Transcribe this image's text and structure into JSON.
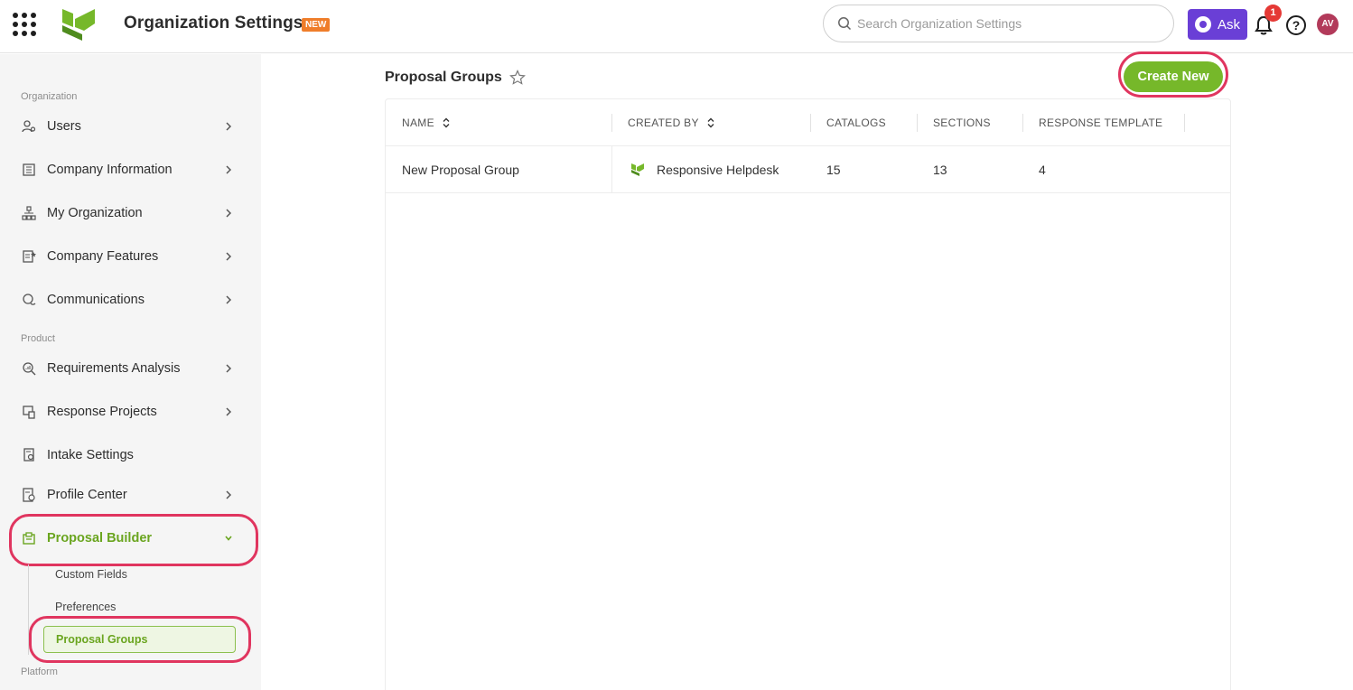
{
  "header": {
    "title": "Organization Settings",
    "badge": "NEW",
    "search_placeholder": "Search Organization Settings",
    "ask_label": "Ask",
    "notification_count": "1",
    "help_label": "?",
    "avatar_initials": "AV"
  },
  "sidebar": {
    "sections": {
      "organization": "Organization",
      "product": "Product",
      "platform": "Platform"
    },
    "items": [
      {
        "label": "Users",
        "icon": "users-icon"
      },
      {
        "label": "Company Information",
        "icon": "building-icon"
      },
      {
        "label": "My Organization",
        "icon": "org-chart-icon"
      },
      {
        "label": "Company Features",
        "icon": "features-icon"
      },
      {
        "label": "Communications",
        "icon": "chat-icon"
      },
      {
        "label": "Requirements Analysis",
        "icon": "search-analysis-icon"
      },
      {
        "label": "Response Projects",
        "icon": "projects-icon"
      },
      {
        "label": "Intake Settings",
        "icon": "intake-icon"
      },
      {
        "label": "Profile Center",
        "icon": "profile-icon"
      },
      {
        "label": "Proposal Builder",
        "icon": "proposal-icon"
      }
    ],
    "proposal_builder_subitems": [
      {
        "label": "Custom Fields"
      },
      {
        "label": "Preferences"
      },
      {
        "label": "Proposal Groups"
      }
    ]
  },
  "main": {
    "title": "Proposal Groups",
    "create_button": "Create New",
    "columns": [
      "NAME",
      "CREATED BY",
      "CATALOGS",
      "SECTIONS",
      "RESPONSE TEMPLATE"
    ],
    "rows": [
      {
        "name": "New Proposal Group",
        "created_by": "Responsive Helpdesk",
        "catalogs": "15",
        "sections": "13",
        "response_template": "4"
      }
    ]
  },
  "colors": {
    "brand_green": "#76b82a",
    "active_green": "#6aa51f",
    "ask_purple": "#6a3fd6",
    "highlight_pink": "#e0355f",
    "badge_orange": "#ef7d2a"
  }
}
